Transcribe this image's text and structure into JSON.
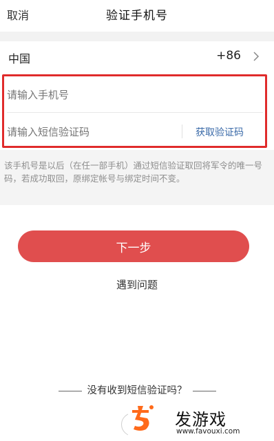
{
  "header": {
    "cancel_label": "取消",
    "title": "验证手机号"
  },
  "country": {
    "name": "中国",
    "code": "+86",
    "chevron_icon": "chevron-right-icon"
  },
  "form": {
    "phone_placeholder": "请输入手机号",
    "sms_placeholder": "请输入短信验证码",
    "get_code_label": "获取验证码"
  },
  "note": "该手机号是以后（在任一部手机）通过短信验证取回将军令的唯一号码，若成功取回，原绑定帐号与绑定时间不变。",
  "actions": {
    "next_label": "下一步",
    "problem_label": "遇到问题"
  },
  "footer": {
    "no_sms_label": "没有收到短信验证吗？"
  },
  "watermark": {
    "brand": "发游戏",
    "url": "www.favouxi.com"
  },
  "colors": {
    "accent_red": "#e04e4e",
    "highlight_border": "#e02b2b",
    "link_blue": "#3a6aa8"
  }
}
